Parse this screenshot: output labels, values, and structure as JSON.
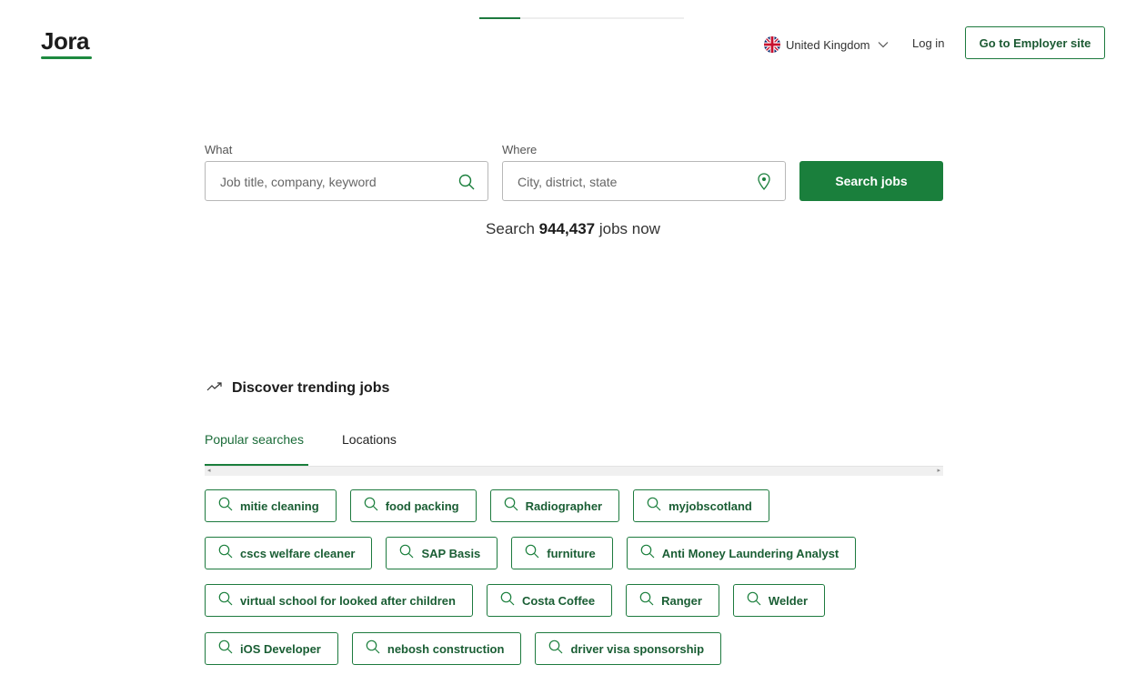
{
  "header": {
    "logo_text": "Jora",
    "country_label": "United Kingdom",
    "login_label": "Log in",
    "employer_button_label": "Go to Employer site"
  },
  "search": {
    "what_label": "What",
    "what_placeholder": "Job title, company, keyword",
    "where_label": "Where",
    "where_placeholder": "City, district, state",
    "button_label": "Search jobs",
    "count_prefix": "Search",
    "count_value": "944,437",
    "count_suffix": "jobs now"
  },
  "trending": {
    "heading": "Discover trending jobs",
    "tabs": [
      {
        "label": "Popular searches",
        "active": true
      },
      {
        "label": "Locations",
        "active": false
      }
    ],
    "chips": [
      [
        "mitie cleaning",
        "food packing",
        "Radiographer",
        "myjobscotland"
      ],
      [
        "cscs welfare cleaner",
        "SAP Basis",
        "furniture",
        "Anti Money Laundering Analyst"
      ],
      [
        "virtual school for looked after children",
        "Costa Coffee",
        "Ranger",
        "Welder"
      ],
      [
        "iOS Developer",
        "nebosh construction",
        "driver visa sponsorship"
      ]
    ]
  },
  "colors": {
    "brand_green": "#1a7f3c",
    "chip_text": "#1a5e34",
    "border_gray": "#b8b8b8"
  },
  "icons": {
    "what_field": "search-icon",
    "where_field": "location-pin-icon",
    "trending": "trending-up-icon",
    "country": "uk-flag-icon"
  }
}
